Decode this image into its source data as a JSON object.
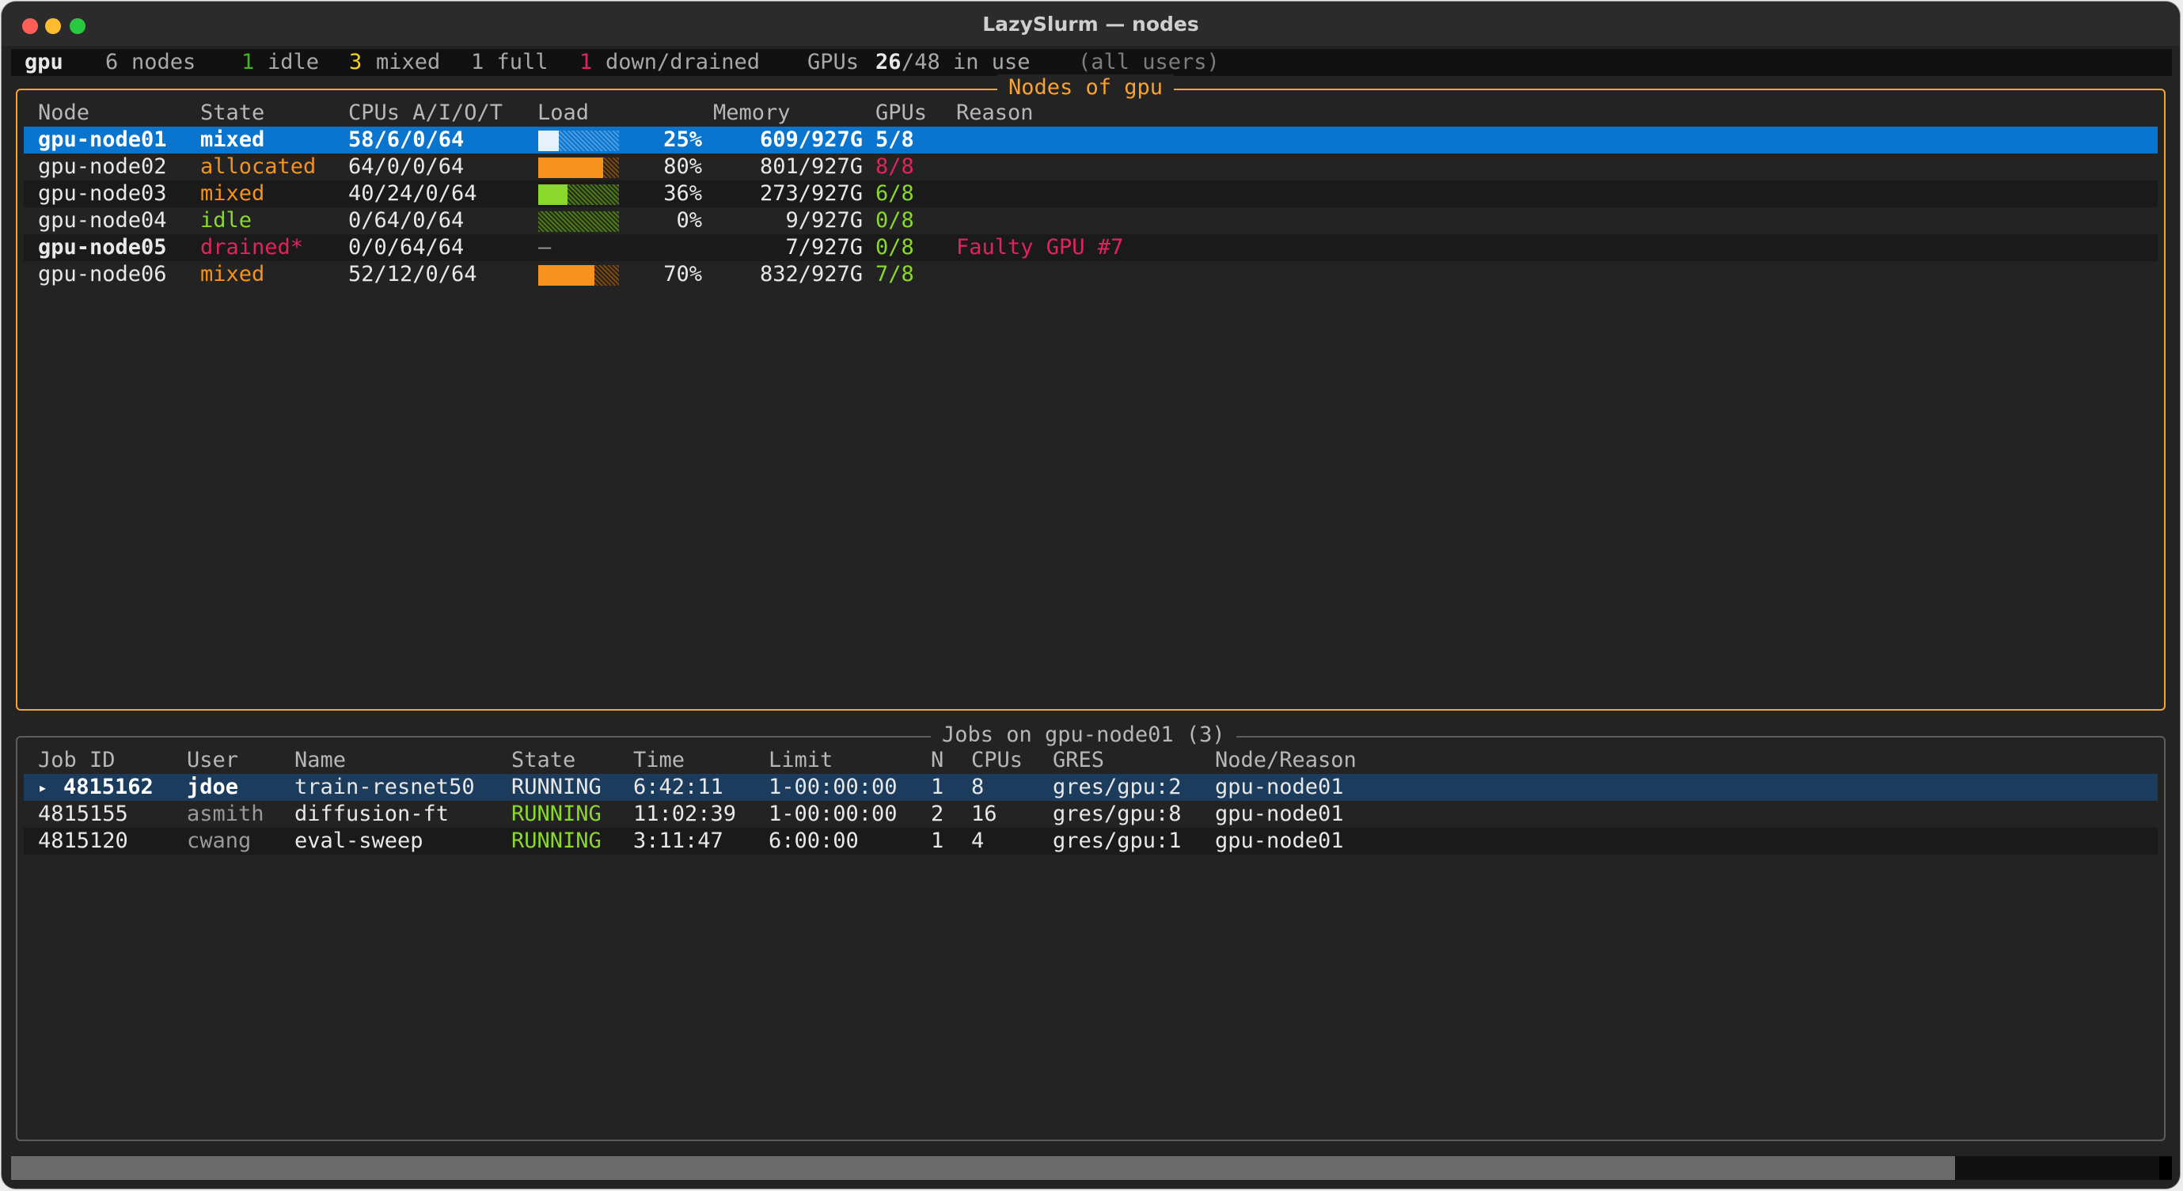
{
  "window": {
    "title": "LazySlurm — nodes"
  },
  "status": {
    "partition": "gpu",
    "nodes_count": "6",
    "nodes_label": "nodes",
    "idle_count": "1",
    "idle_label": "idle",
    "mixed_count": "3",
    "mixed_label": "mixed",
    "full_label": "1 full",
    "down_count": "1",
    "down_label": "down/drained",
    "gpus_label": "GPUs",
    "gpus_used": "26",
    "gpus_total": "/48 in use",
    "scope": "(all users)"
  },
  "colors": {
    "accent": "#f7a334",
    "select": "#0a75cf",
    "select_dim": "#1b3c5c",
    "green": "#8ad82a",
    "orange": "#f7921e",
    "red": "#e0245e",
    "text": "#e8e8e8",
    "muted": "#9a9a9a"
  },
  "nodes_panel": {
    "title": "Nodes of gpu",
    "headers": {
      "node": "Node",
      "state": "State",
      "cpus": "CPUs A/I/O/T",
      "load": "Load",
      "memory": "Memory",
      "gpus": "GPUs",
      "reason": "Reason"
    },
    "rows": [
      {
        "node": "gpu-node01",
        "state": "mixed",
        "cpus": "58/6/0/64",
        "load_pct": "25%",
        "load_value": 0.25,
        "memory": "609/927G",
        "gpus": "5/8",
        "reason": ""
      },
      {
        "node": "gpu-node02",
        "state": "allocated",
        "cpus": "64/0/0/64",
        "load_pct": "80%",
        "load_value": 0.8,
        "memory": "801/927G",
        "gpus": "8/8",
        "reason": ""
      },
      {
        "node": "gpu-node03",
        "state": "mixed",
        "cpus": "40/24/0/64",
        "load_pct": "36%",
        "load_value": 0.36,
        "memory": "273/927G",
        "gpus": "6/8",
        "reason": ""
      },
      {
        "node": "gpu-node04",
        "state": "idle",
        "cpus": "0/64/0/64",
        "load_pct": "0%",
        "load_value": 0.0,
        "memory": "9/927G",
        "gpus": "0/8",
        "reason": ""
      },
      {
        "node": "gpu-node05",
        "state": "drained*",
        "cpus": "0/0/64/64",
        "load_pct": "",
        "load_dash": "–",
        "memory": "7/927G",
        "gpus": "0/8",
        "reason": "Faulty GPU #7"
      },
      {
        "node": "gpu-node06",
        "state": "mixed",
        "cpus": "52/12/0/64",
        "load_pct": "70%",
        "load_value": 0.7,
        "memory": "832/927G",
        "gpus": "7/8",
        "reason": ""
      }
    ]
  },
  "jobs_panel": {
    "title": "Jobs on gpu-node01 (3)",
    "headers": {
      "jobid": "Job ID",
      "user": "User",
      "name": "Name",
      "state": "State",
      "time": "Time",
      "limit": "Limit",
      "n": "N",
      "cpus": "CPUs",
      "gres": "GRES",
      "nodereason": "Node/Reason"
    },
    "rows": [
      {
        "marker": "▸",
        "jobid": "4815162",
        "user": "jdoe",
        "name": "train-resnet50",
        "state": "RUNNING",
        "time": "6:42:11",
        "limit": "1-00:00:00",
        "n": "1",
        "cpus": "8",
        "gres": "gres/gpu:2",
        "nodereason": "gpu-node01"
      },
      {
        "marker": "",
        "jobid": "4815155",
        "user": "asmith",
        "name": "diffusion-ft",
        "state": "RUNNING",
        "time": "11:02:39",
        "limit": "1-00:00:00",
        "n": "2",
        "cpus": "16",
        "gres": "gres/gpu:8",
        "nodereason": "gpu-node01"
      },
      {
        "marker": "",
        "jobid": "4815120",
        "user": "cwang",
        "name": "eval-sweep",
        "state": "RUNNING",
        "time": "3:11:47",
        "limit": "6:00:00",
        "n": "1",
        "cpus": "4",
        "gres": "gres/gpu:1",
        "nodereason": "gpu-node01"
      }
    ]
  },
  "scrollbar": {
    "position": 0.9
  }
}
